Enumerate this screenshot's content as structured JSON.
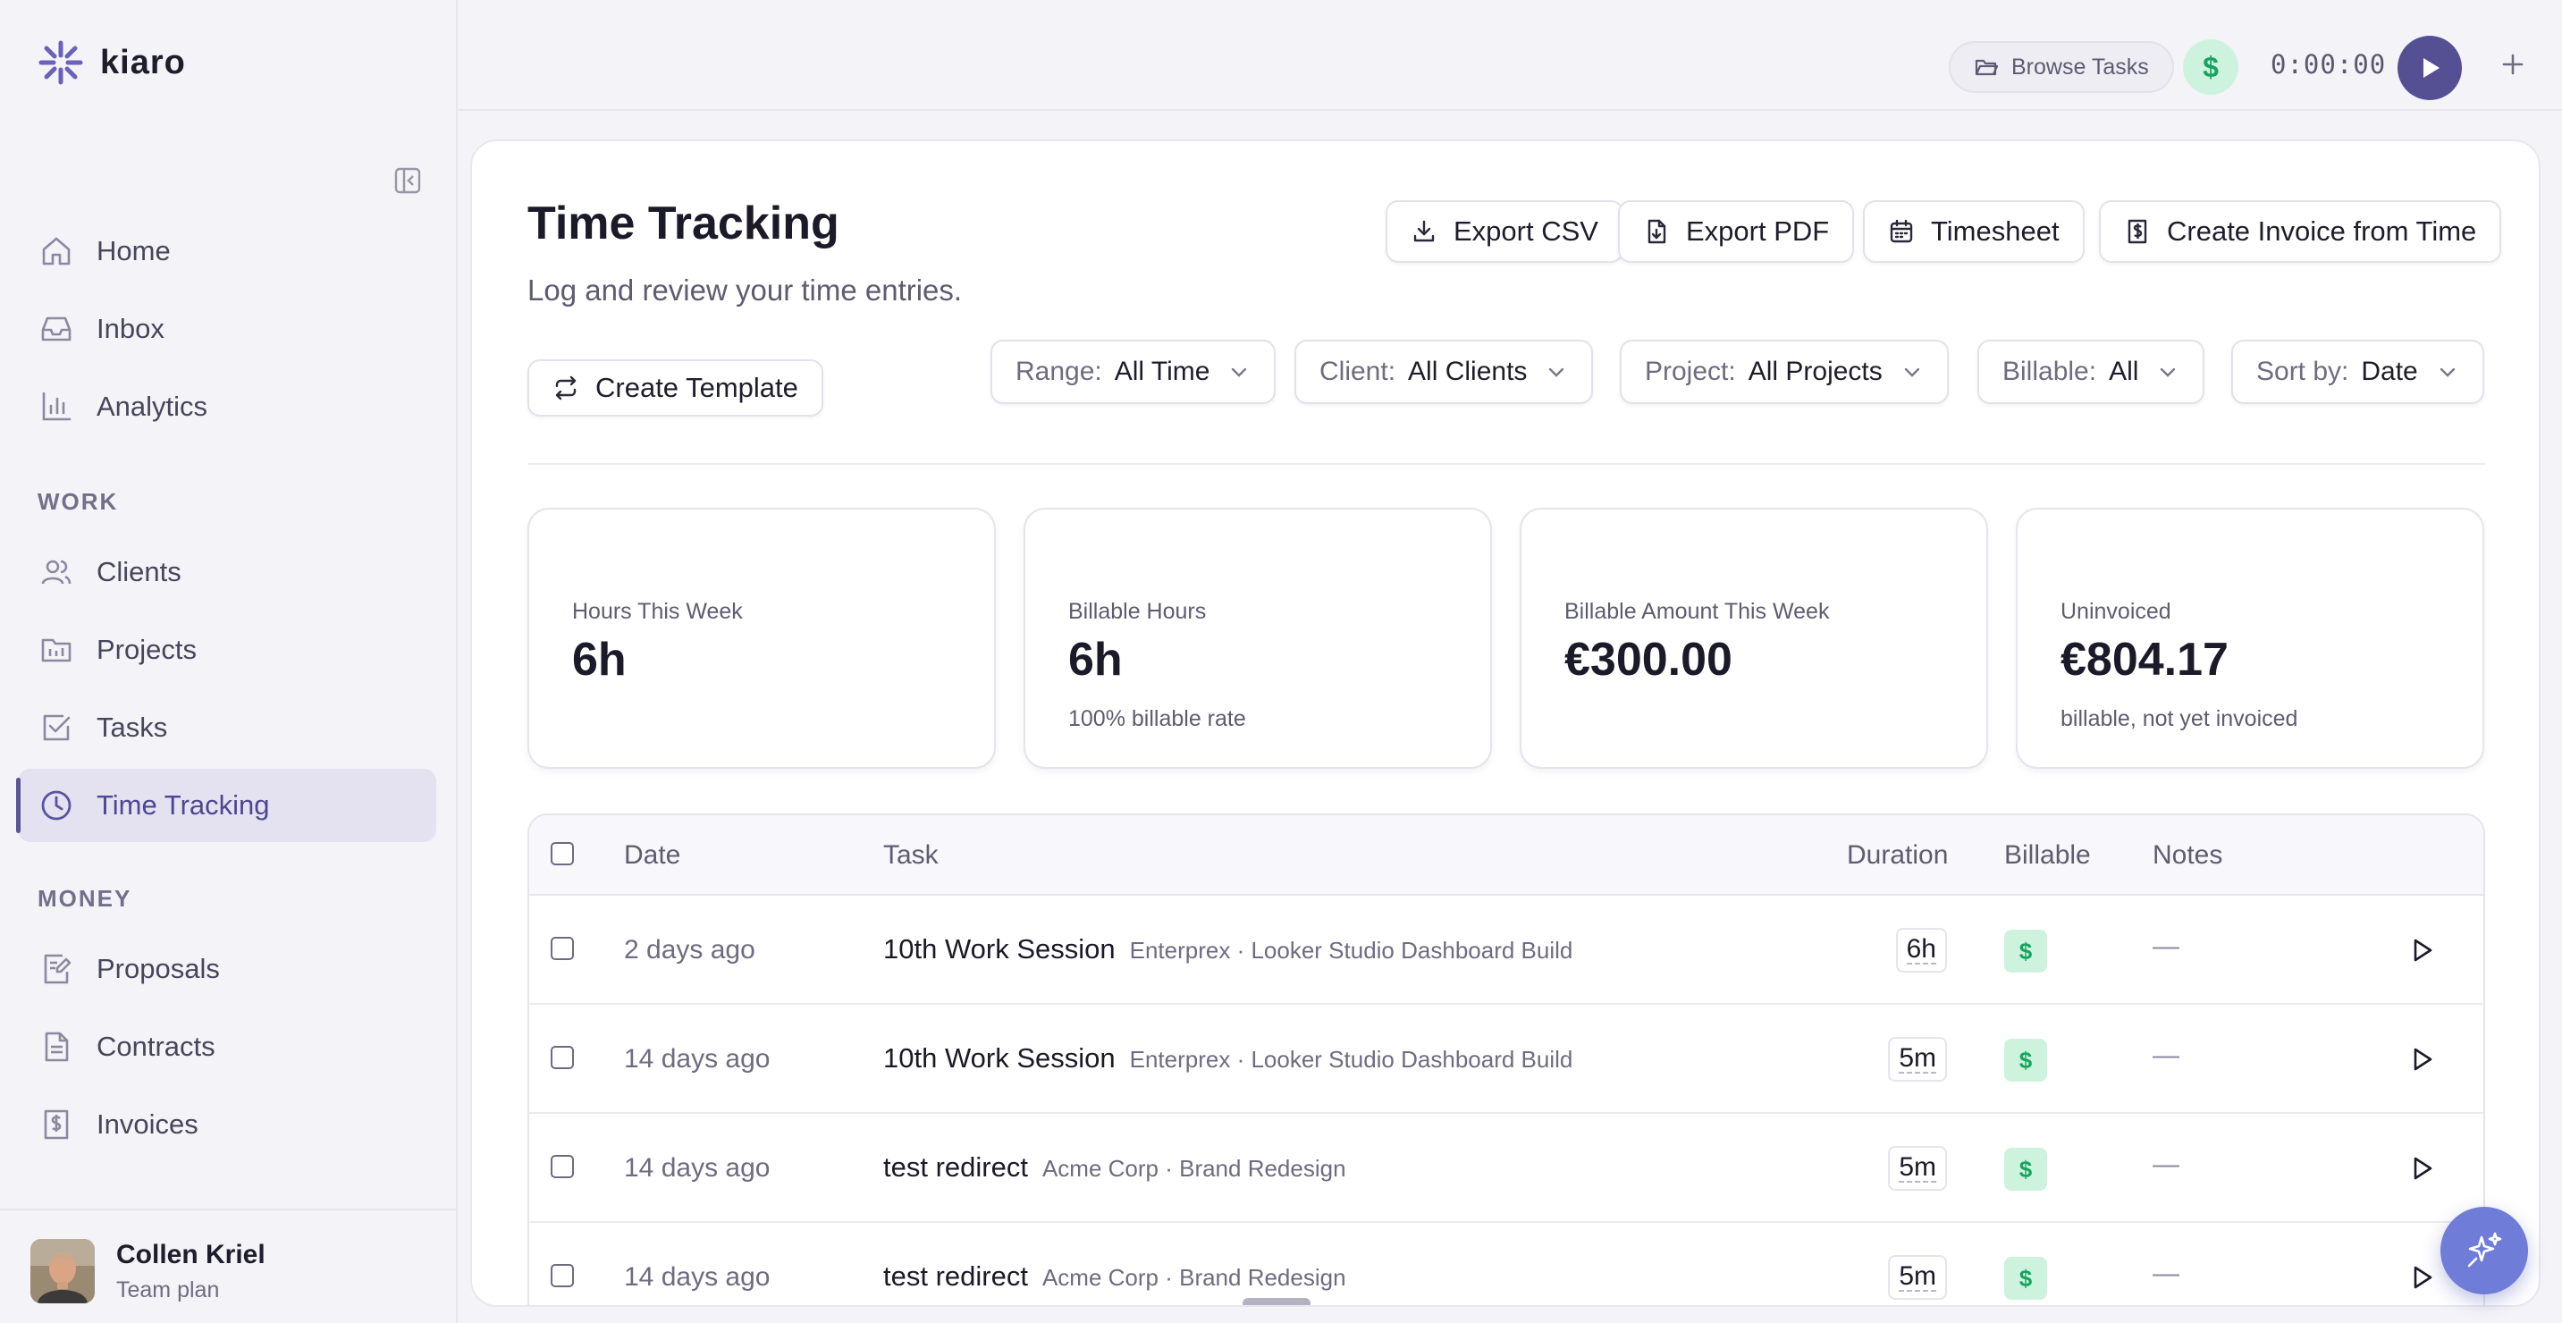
{
  "app": {
    "name": "kiaro"
  },
  "sidebar": {
    "nav_main": [
      {
        "label": "Home",
        "icon": "home-icon"
      },
      {
        "label": "Inbox",
        "icon": "inbox-icon"
      },
      {
        "label": "Analytics",
        "icon": "analytics-icon"
      }
    ],
    "section_work": "WORK",
    "nav_work": [
      {
        "label": "Clients",
        "icon": "users-icon"
      },
      {
        "label": "Projects",
        "icon": "folder-icon"
      },
      {
        "label": "Tasks",
        "icon": "checkbox-icon"
      },
      {
        "label": "Time Tracking",
        "icon": "clock-icon",
        "active": true
      }
    ],
    "section_money": "MONEY",
    "nav_money": [
      {
        "label": "Proposals",
        "icon": "proposal-icon"
      },
      {
        "label": "Contracts",
        "icon": "document-icon"
      },
      {
        "label": "Invoices",
        "icon": "invoice-icon"
      }
    ],
    "user": {
      "name": "Collen Kriel",
      "plan": "Team plan"
    }
  },
  "topbar": {
    "browse_label": "Browse Tasks",
    "billable_symbol": "$",
    "timer": "0:00:00"
  },
  "page": {
    "title": "Time Tracking",
    "subtitle": "Log and review your time entries.",
    "actions": {
      "export_csv": "Export CSV",
      "export_pdf": "Export PDF",
      "timesheet": "Timesheet",
      "create_invoice": "Create Invoice from Time",
      "create_template": "Create Template"
    },
    "filters": {
      "range": {
        "label": "Range:",
        "value": "All Time"
      },
      "client": {
        "label": "Client:",
        "value": "All Clients"
      },
      "project": {
        "label": "Project:",
        "value": "All Projects"
      },
      "billable": {
        "label": "Billable:",
        "value": "All"
      },
      "sort": {
        "label": "Sort by:",
        "value": "Date"
      }
    },
    "stats": [
      {
        "label": "Hours This Week",
        "value": "6h",
        "sub": ""
      },
      {
        "label": "Billable Hours",
        "value": "6h",
        "sub": "100% billable rate"
      },
      {
        "label": "Billable Amount This Week",
        "value": "€300.00",
        "sub": ""
      },
      {
        "label": "Uninvoiced",
        "value": "€804.17",
        "sub": "billable, not yet invoiced"
      }
    ]
  },
  "table": {
    "columns": {
      "date": "Date",
      "task": "Task",
      "duration": "Duration",
      "billable": "Billable",
      "notes": "Notes"
    },
    "rows": [
      {
        "date": "2 days ago",
        "task": "10th Work Session",
        "meta": "Enterprex · Looker Studio Dashboard Build",
        "duration": "6h",
        "billable": "$",
        "notes": "—"
      },
      {
        "date": "14 days ago",
        "task": "10th Work Session",
        "meta": "Enterprex · Looker Studio Dashboard Build",
        "duration": "5m",
        "billable": "$",
        "notes": "—"
      },
      {
        "date": "14 days ago",
        "task": "test redirect",
        "meta": "Acme Corp · Brand Redesign",
        "duration": "5m",
        "billable": "$",
        "notes": "—"
      },
      {
        "date": "14 days ago",
        "task": "test redirect",
        "meta": "Acme Corp · Brand Redesign",
        "duration": "5m",
        "billable": "$",
        "notes": "—"
      }
    ]
  },
  "colors": {
    "accent": "#554f93",
    "active_bg": "#e4e1f0",
    "billable_bg": "#cdf3de",
    "billable_fg": "#18a35f",
    "fab": "#6f7cd8"
  }
}
